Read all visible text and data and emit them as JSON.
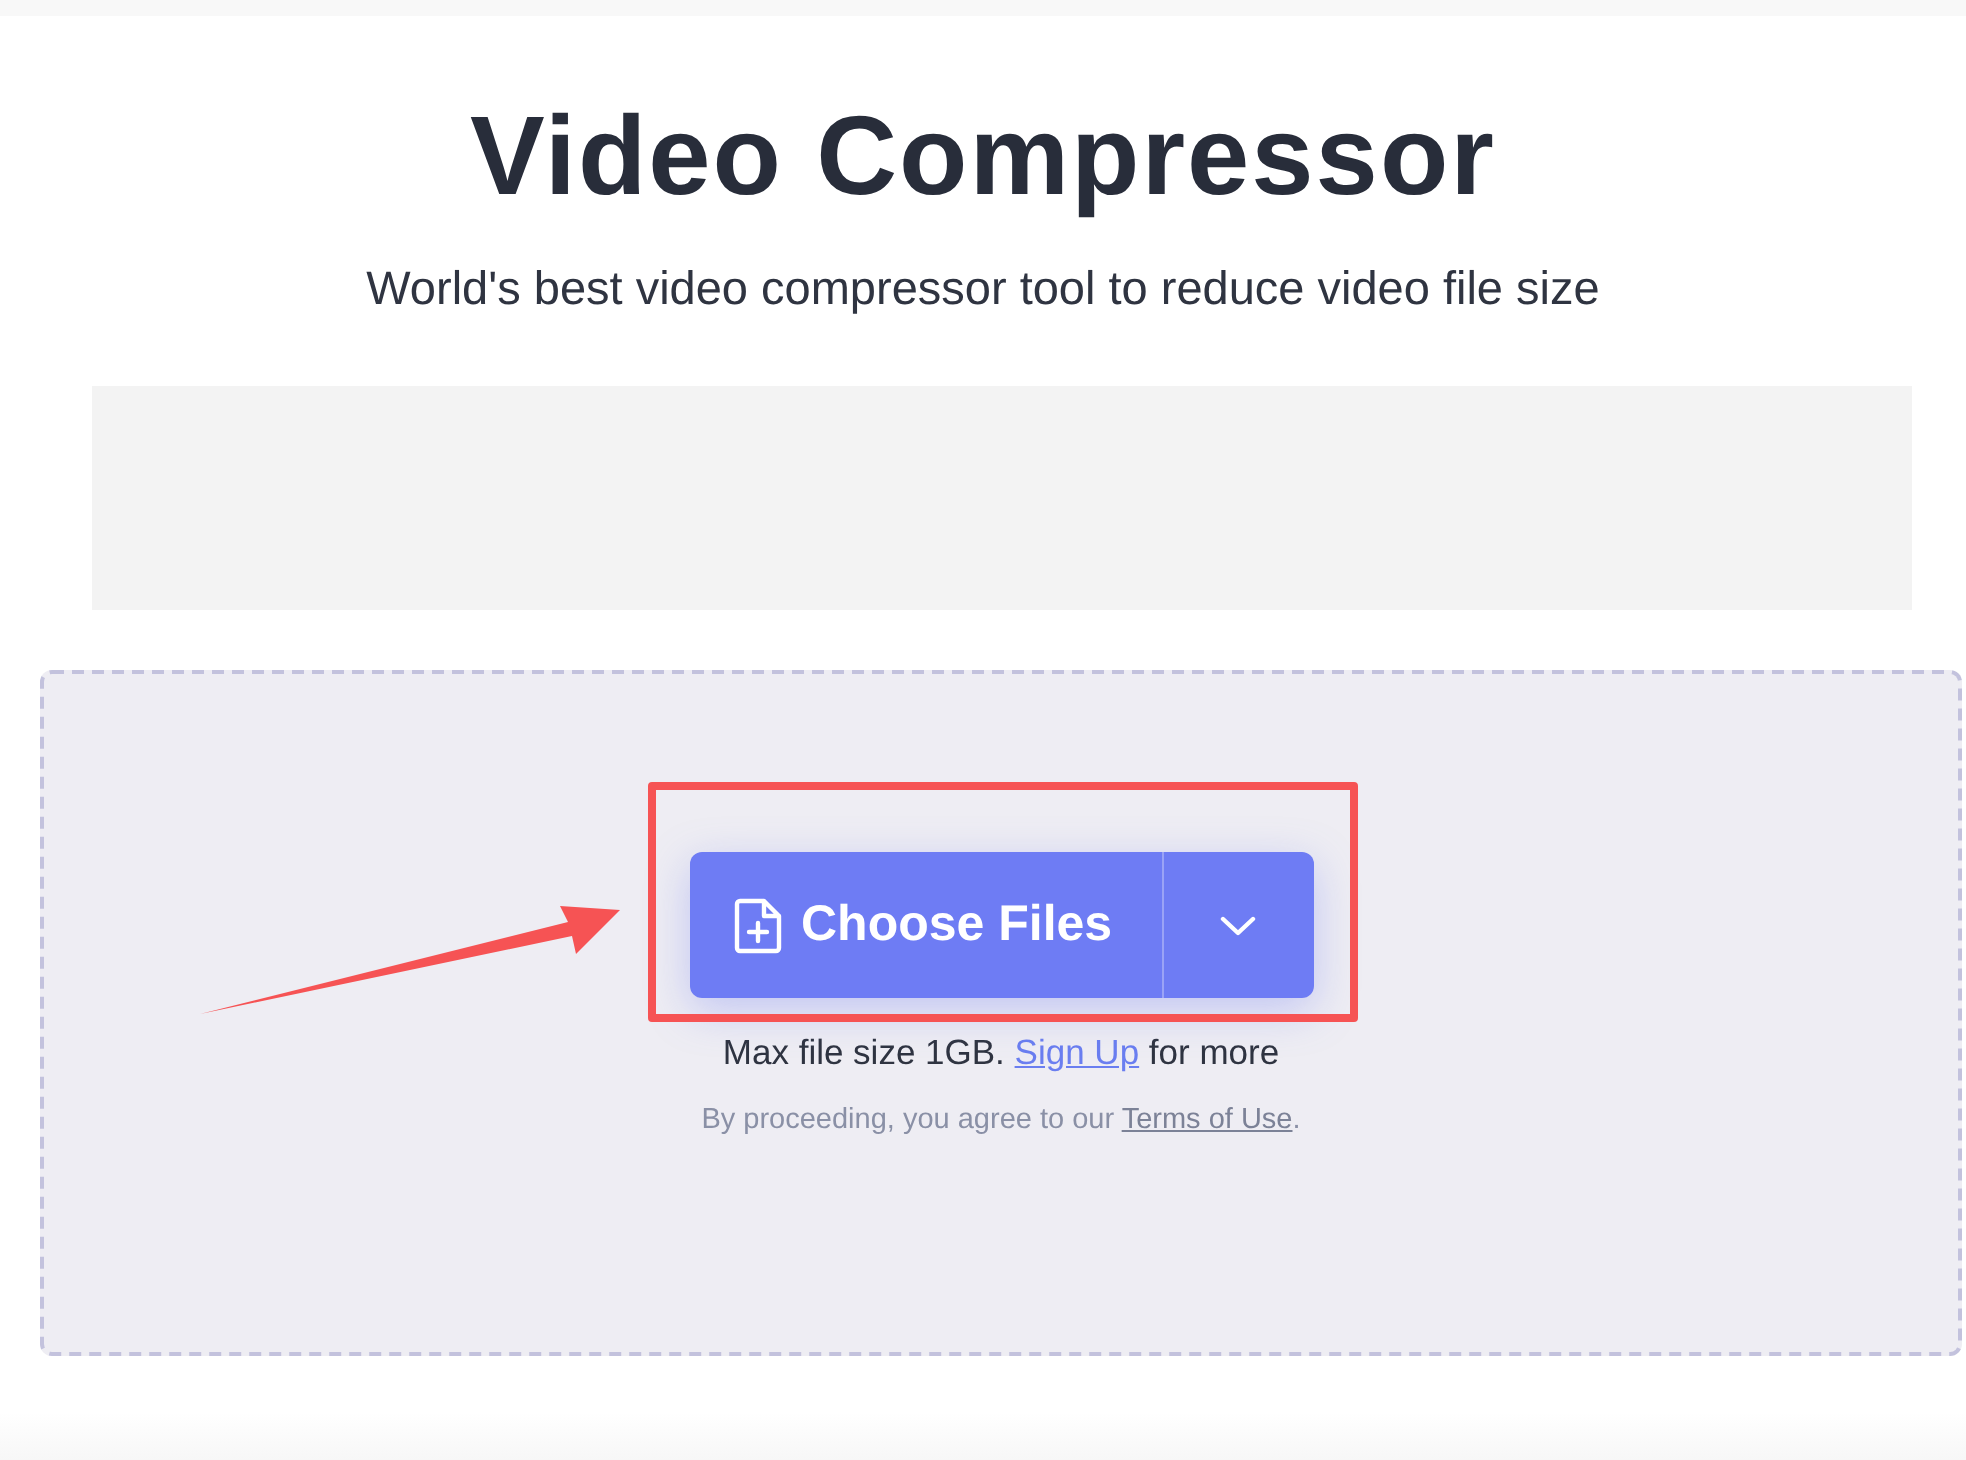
{
  "header": {
    "title": "Video Compressor",
    "subtitle": "World's best video compressor tool to reduce video file size"
  },
  "upload": {
    "button": {
      "label": "Choose Files"
    },
    "limit": {
      "before": "Max file size 1GB.",
      "link": "Sign Up",
      "after": "for more"
    },
    "terms": {
      "before": "By proceeding, you agree to our",
      "link": "Terms of Use",
      "after": "."
    }
  }
}
